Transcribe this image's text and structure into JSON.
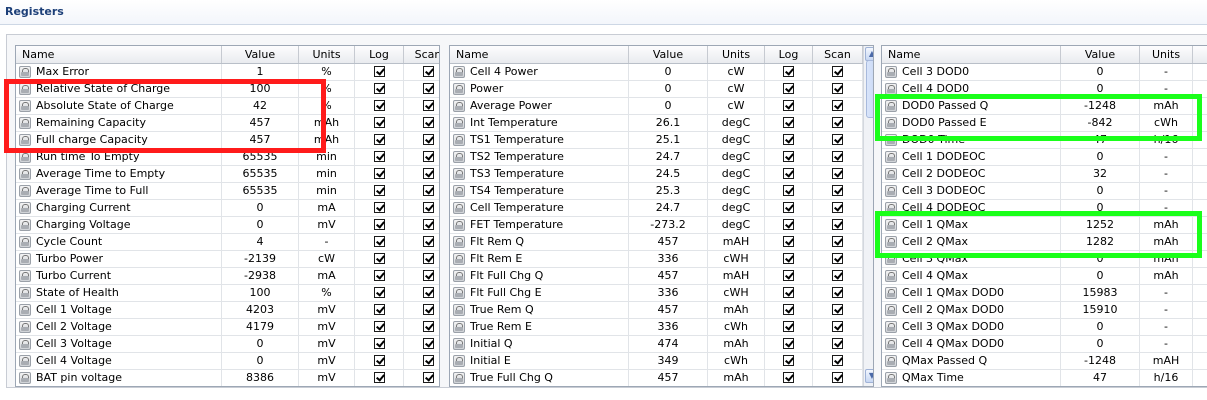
{
  "header": {
    "title": "Registers"
  },
  "columns": {
    "name": "Name",
    "value": "Value",
    "units": "Units",
    "log": "Log",
    "scan": "Scan"
  },
  "panels": [
    {
      "rows": [
        {
          "name": "Max Error",
          "value": "1",
          "units": "%",
          "log": true,
          "scan": true
        },
        {
          "name": "Relative State of Charge",
          "value": "100",
          "units": "%",
          "log": true,
          "scan": true
        },
        {
          "name": "Absolute State of Charge",
          "value": "42",
          "units": "%",
          "log": true,
          "scan": true
        },
        {
          "name": "Remaining Capacity",
          "value": "457",
          "units": "mAh",
          "log": true,
          "scan": true
        },
        {
          "name": "Full charge Capacity",
          "value": "457",
          "units": "mAh",
          "log": true,
          "scan": true
        },
        {
          "name": "Run time To Empty",
          "value": "65535",
          "units": "min",
          "log": true,
          "scan": true
        },
        {
          "name": "Average Time to Empty",
          "value": "65535",
          "units": "min",
          "log": true,
          "scan": true
        },
        {
          "name": "Average Time to Full",
          "value": "65535",
          "units": "min",
          "log": true,
          "scan": true
        },
        {
          "name": "Charging Current",
          "value": "0",
          "units": "mA",
          "log": true,
          "scan": true
        },
        {
          "name": "Charging Voltage",
          "value": "0",
          "units": "mV",
          "log": true,
          "scan": true
        },
        {
          "name": "Cycle Count",
          "value": "4",
          "units": "-",
          "log": true,
          "scan": true
        },
        {
          "name": "Turbo Power",
          "value": "-2139",
          "units": "cW",
          "log": true,
          "scan": true
        },
        {
          "name": "Turbo Current",
          "value": "-2938",
          "units": "mA",
          "log": true,
          "scan": true
        },
        {
          "name": "State of Health",
          "value": "100",
          "units": "%",
          "log": true,
          "scan": true
        },
        {
          "name": "Cell 1 Voltage",
          "value": "4203",
          "units": "mV",
          "log": true,
          "scan": true
        },
        {
          "name": "Cell 2 Voltage",
          "value": "4179",
          "units": "mV",
          "log": true,
          "scan": true
        },
        {
          "name": "Cell 3 Voltage",
          "value": "0",
          "units": "mV",
          "log": true,
          "scan": true
        },
        {
          "name": "Cell 4 Voltage",
          "value": "0",
          "units": "mV",
          "log": true,
          "scan": true
        },
        {
          "name": "BAT pin voltage",
          "value": "8386",
          "units": "mV",
          "log": true,
          "scan": true
        }
      ]
    },
    {
      "rows": [
        {
          "name": "Cell 4 Power",
          "value": "0",
          "units": "cW",
          "log": true,
          "scan": true
        },
        {
          "name": "Power",
          "value": "0",
          "units": "cW",
          "log": true,
          "scan": true
        },
        {
          "name": "Average Power",
          "value": "0",
          "units": "cW",
          "log": true,
          "scan": true
        },
        {
          "name": "Int Temperature",
          "value": "26.1",
          "units": "degC",
          "log": true,
          "scan": true
        },
        {
          "name": "TS1 Temperature",
          "value": "25.1",
          "units": "degC",
          "log": true,
          "scan": true
        },
        {
          "name": "TS2 Temperature",
          "value": "24.7",
          "units": "degC",
          "log": true,
          "scan": true
        },
        {
          "name": "TS3 Temperature",
          "value": "24.5",
          "units": "degC",
          "log": true,
          "scan": true
        },
        {
          "name": "TS4 Temperature",
          "value": "25.3",
          "units": "degC",
          "log": true,
          "scan": true
        },
        {
          "name": "Cell Temperature",
          "value": "24.7",
          "units": "degC",
          "log": true,
          "scan": true
        },
        {
          "name": "FET Temperature",
          "value": "-273.2",
          "units": "degC",
          "log": true,
          "scan": true
        },
        {
          "name": "Flt Rem Q",
          "value": "457",
          "units": "mAH",
          "log": true,
          "scan": true
        },
        {
          "name": "Flt Rem E",
          "value": "336",
          "units": "cWH",
          "log": true,
          "scan": true
        },
        {
          "name": "Flt Full Chg Q",
          "value": "457",
          "units": "mAH",
          "log": true,
          "scan": true
        },
        {
          "name": "Flt Full Chg E",
          "value": "336",
          "units": "cWH",
          "log": true,
          "scan": true
        },
        {
          "name": "True Rem Q",
          "value": "457",
          "units": "mAh",
          "log": true,
          "scan": true
        },
        {
          "name": "True Rem E",
          "value": "336",
          "units": "cWh",
          "log": true,
          "scan": true
        },
        {
          "name": "Initial Q",
          "value": "474",
          "units": "mAh",
          "log": true,
          "scan": true
        },
        {
          "name": "Initial E",
          "value": "349",
          "units": "cWh",
          "log": true,
          "scan": true
        },
        {
          "name": "True Full Chg Q",
          "value": "457",
          "units": "mAh",
          "log": true,
          "scan": true
        }
      ]
    },
    {
      "rows": [
        {
          "name": "Cell 3 DOD0",
          "value": "0",
          "units": "-"
        },
        {
          "name": "Cell 4 DOD0",
          "value": "0",
          "units": "-"
        },
        {
          "name": "DOD0 Passed Q",
          "value": "-1248",
          "units": "mAh"
        },
        {
          "name": "DOD0 Passed E",
          "value": "-842",
          "units": "cWh"
        },
        {
          "name": "DOD0 Time",
          "value": "47",
          "units": "h/16"
        },
        {
          "name": "Cell 1 DODEOC",
          "value": "0",
          "units": "-"
        },
        {
          "name": "Cell 2 DODEOC",
          "value": "32",
          "units": "-"
        },
        {
          "name": "Cell 3 DODEOC",
          "value": "0",
          "units": "-"
        },
        {
          "name": "Cell 4 DODEOC",
          "value": "0",
          "units": "-"
        },
        {
          "name": "Cell 1 QMax",
          "value": "1252",
          "units": "mAh"
        },
        {
          "name": "Cell 2 QMax",
          "value": "1282",
          "units": "mAh"
        },
        {
          "name": "Cell 3 QMax",
          "value": "0",
          "units": "mAh"
        },
        {
          "name": "Cell 4 QMax",
          "value": "0",
          "units": "mAh"
        },
        {
          "name": "Cell 1 QMax DOD0",
          "value": "15983",
          "units": "-"
        },
        {
          "name": "Cell 2 QMax DOD0",
          "value": "15910",
          "units": "-"
        },
        {
          "name": "Cell 3 QMax DOD0",
          "value": "0",
          "units": "-"
        },
        {
          "name": "Cell 4 QMax DOD0",
          "value": "0",
          "units": "-"
        },
        {
          "name": "QMax Passed Q",
          "value": "-1248",
          "units": "mAH"
        },
        {
          "name": "QMax Time",
          "value": "47",
          "units": "h/16"
        }
      ]
    }
  ],
  "highlight_colors": {
    "red": "#ff1b1b",
    "green": "#1aff1a"
  },
  "icons": {
    "row_icon": "lock-icon",
    "scroll_up": "scroll-up-arrow-icon",
    "scroll_down": "scroll-down-arrow-icon"
  }
}
